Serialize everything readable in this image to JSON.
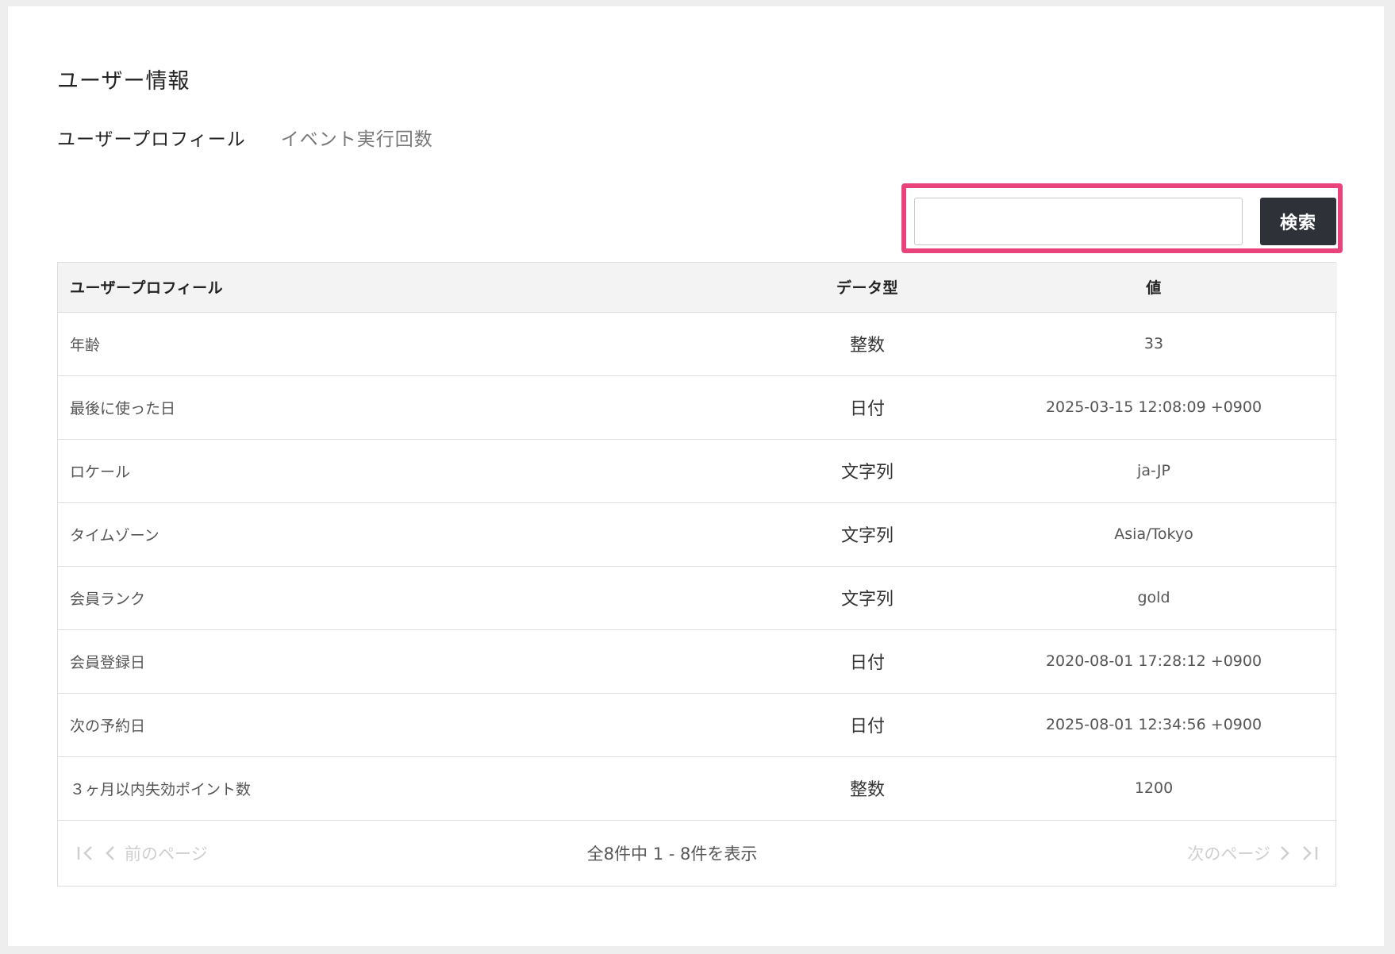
{
  "page": {
    "title": "ユーザー情報"
  },
  "tabs": [
    {
      "label": "ユーザープロフィール",
      "active": true
    },
    {
      "label": "イベント実行回数",
      "active": false
    }
  ],
  "search": {
    "value": "",
    "placeholder": "",
    "button_label": "検索",
    "highlight_color": "#e8437a"
  },
  "table": {
    "headers": {
      "name": "ユーザープロフィール",
      "type": "データ型",
      "value": "値"
    },
    "rows": [
      {
        "name": "年齢",
        "type": "整数",
        "value": "33"
      },
      {
        "name": "最後に使った日",
        "type": "日付",
        "value": "2025-03-15 12:08:09 +0900"
      },
      {
        "name": "ロケール",
        "type": "文字列",
        "value": "ja-JP"
      },
      {
        "name": "タイムゾーン",
        "type": "文字列",
        "value": "Asia/Tokyo"
      },
      {
        "name": "会員ランク",
        "type": "文字列",
        "value": "gold"
      },
      {
        "name": "会員登録日",
        "type": "日付",
        "value": "2020-08-01 17:28:12 +0900"
      },
      {
        "name": "次の予約日",
        "type": "日付",
        "value": "2025-08-01 12:34:56 +0900"
      },
      {
        "name": "３ヶ月以内失効ポイント数",
        "type": "整数",
        "value": "1200"
      }
    ]
  },
  "pagination": {
    "prev_label": "前のページ",
    "next_label": "次のページ",
    "summary": "全8件中 1 - 8件を表示",
    "icons": {
      "first": "first-page-icon",
      "prev": "chevron-left-icon",
      "next": "chevron-right-icon",
      "last": "last-page-icon"
    }
  },
  "colors": {
    "button_bg": "#2e3138",
    "header_bg": "#f3f3f3",
    "disabled_text": "#cfcfcf"
  }
}
